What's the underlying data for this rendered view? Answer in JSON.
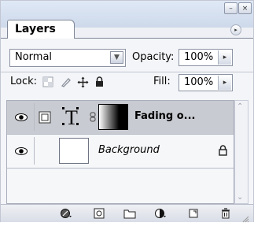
{
  "panel": {
    "tab_label": "Layers",
    "menu_glyph": "▸"
  },
  "window_buttons": {
    "minimize": "–",
    "close": "×"
  },
  "blend_mode": {
    "value": "Normal",
    "arrow": "▼"
  },
  "opacity": {
    "label": "Opacity:",
    "value": "100%",
    "arrow": "▸"
  },
  "lock": {
    "label": "Lock:",
    "icons": [
      "lock-transparent-pixels-icon",
      "lock-image-pixels-icon",
      "lock-position-icon",
      "lock-all-icon"
    ]
  },
  "fill": {
    "label": "Fill:",
    "value": "100%",
    "arrow": "▸"
  },
  "layers": [
    {
      "name": "Fading o...",
      "visible": true,
      "selected": true,
      "kind": "text"
    },
    {
      "name": "Background",
      "visible": true,
      "selected": false,
      "locked": true
    }
  ],
  "bottom_icons": [
    "link-layers-icon",
    "layer-style-icon",
    "layer-mask-icon",
    "new-group-icon",
    "adjustment-layer-icon",
    "new-layer-icon",
    "delete-layer-icon"
  ],
  "colors": {
    "selected_row": "#c9cbd2",
    "titlebar": "#d6e0ef"
  }
}
